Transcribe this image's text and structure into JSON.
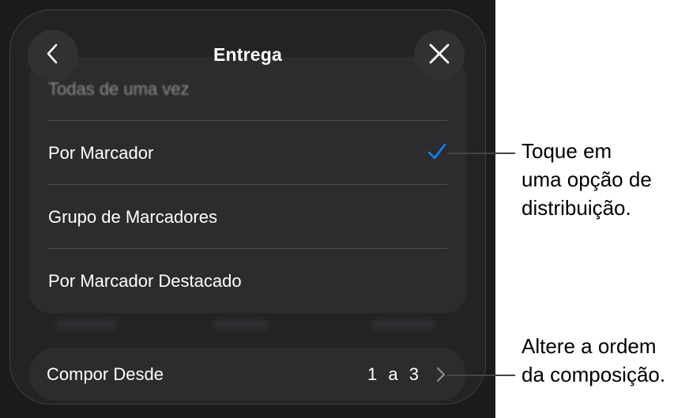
{
  "header": {
    "title": "Entrega"
  },
  "options": [
    {
      "label": "Todas de uma vez",
      "selected": false
    },
    {
      "label": "Por Marcador",
      "selected": true
    },
    {
      "label": "Grupo de Marcadores",
      "selected": false
    },
    {
      "label": "Por Marcador Destacado",
      "selected": false
    }
  ],
  "build_order": {
    "label": "Compor Desde",
    "range_start": "1",
    "range_separator": "a",
    "range_end": "3"
  },
  "callouts": [
    {
      "lines": [
        "Toque em",
        "uma opção de",
        "distribuição."
      ]
    },
    {
      "lines": [
        "Altere a ordem",
        "da composição."
      ]
    }
  ],
  "colors": {
    "accent": "#0a84ff",
    "background": "#1b1b1d",
    "panel": "#2c2c2e"
  },
  "icons": {
    "back": "chevron-left-icon",
    "close": "close-icon",
    "selected": "checkmark-icon",
    "disclosure": "chevron-right-icon"
  }
}
